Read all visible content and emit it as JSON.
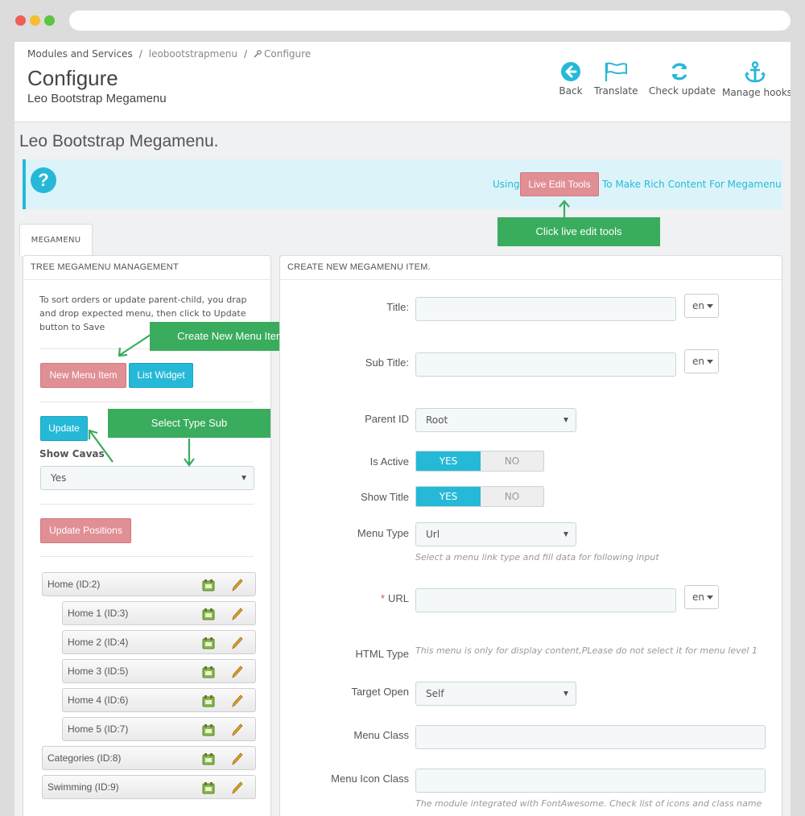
{
  "breadcrumb": {
    "item1": "Modules and Services",
    "item2": "leobootstrapmenu",
    "item3": "Configure"
  },
  "header": {
    "title": "Configure",
    "subtitle": "Leo Bootstrap Megamenu"
  },
  "toolbar": {
    "back": "Back",
    "translate": "Translate",
    "check_update": "Check update",
    "manage_hooks": "Manage hooks"
  },
  "module_title": "Leo Bootstrap Megamenu.",
  "alert": {
    "using": "Using",
    "button": "Live Edit Tools",
    "rest": "To Make Rich Content For Megamenu"
  },
  "callouts": {
    "live_edit": "Click live edit tools",
    "new_item": "Create New Menu Item",
    "select_type": "Select Type Sub"
  },
  "tab": {
    "label": "MEGAMENU"
  },
  "tree_panel": {
    "heading": "TREE MEGAMENU MANAGEMENT",
    "hint": "To sort orders or update parent-child, you drap and drop expected menu, then click to Update button to Save",
    "new_menu_item": "New Menu Item",
    "list_widget": "List Widget",
    "update": "Update",
    "show_cavas_label": "Show Cavas",
    "show_cavas_value": "Yes",
    "update_positions": "Update Positions",
    "items": [
      {
        "label": "Home (ID:2)"
      },
      {
        "label": "Home 1 (ID:3)"
      },
      {
        "label": "Home 2 (ID:4)"
      },
      {
        "label": "Home 3 (ID:5)"
      },
      {
        "label": "Home 4 (ID:6)"
      },
      {
        "label": "Home 5 (ID:7)"
      },
      {
        "label": "Categories (ID:8)"
      },
      {
        "label": "Swimming (ID:9)"
      }
    ]
  },
  "form_panel": {
    "heading": "CREATE NEW MEGAMENU ITEM.",
    "title_label": "Title:",
    "subtitle_label": "Sub Title:",
    "lang": "en",
    "parent_id_label": "Parent ID",
    "parent_id_value": "Root",
    "is_active_label": "Is Active",
    "show_title_label": "Show Title",
    "yes": "YES",
    "no": "NO",
    "menu_type_label": "Menu Type",
    "menu_type_value": "Url",
    "menu_type_help": "Select a menu link type and fill data for following input",
    "url_required": "*",
    "url_label": "URL",
    "html_type_label": "HTML Type",
    "html_type_help": "This menu is only for display content,PLease do not select it for menu level 1",
    "target_open_label": "Target Open",
    "target_open_value": "Self",
    "menu_class_label": "Menu Class",
    "menu_icon_class_label": "Menu Icon Class",
    "icon_help": "The module integrated with FontAwesome. Check list of icons and class name"
  },
  "colors": {
    "accent": "#25b9d7",
    "pink": "#e08f95",
    "callout": "#3aac5d"
  }
}
